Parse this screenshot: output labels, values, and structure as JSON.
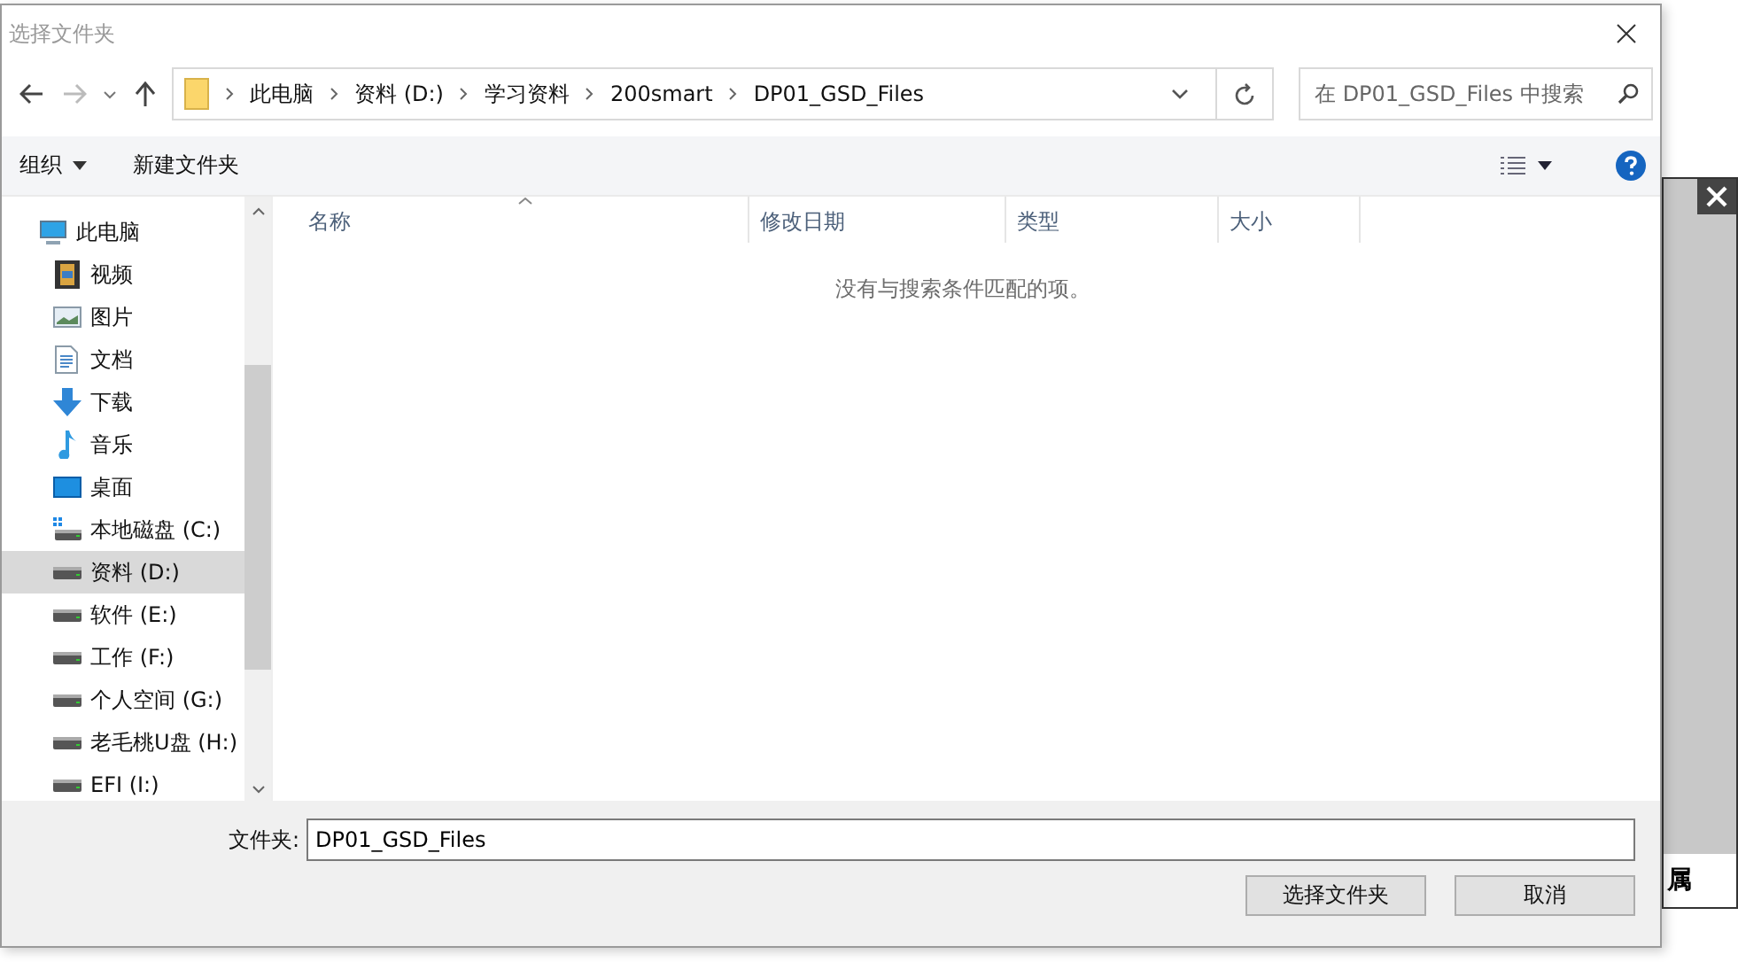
{
  "window": {
    "title": "选择文件夹"
  },
  "address_bar": {
    "segments": [
      "此电脑",
      "资料 (D:)",
      "学习资料",
      "200smart",
      "DP01_GSD_Files"
    ]
  },
  "search": {
    "placeholder": "在 DP01_GSD_Files 中搜索"
  },
  "toolbar": {
    "organize": "组织",
    "new_folder": "新建文件夹"
  },
  "sidebar": {
    "items": [
      {
        "label": "此电脑",
        "kind": "pc",
        "selected": false,
        "children": [
          {
            "label": "视频",
            "kind": "video",
            "selected": false
          },
          {
            "label": "图片",
            "kind": "pictures",
            "selected": false
          },
          {
            "label": "文档",
            "kind": "documents",
            "selected": false
          },
          {
            "label": "下载",
            "kind": "downloads",
            "selected": false
          },
          {
            "label": "音乐",
            "kind": "music",
            "selected": false
          },
          {
            "label": "桌面",
            "kind": "desktop",
            "selected": false
          },
          {
            "label": "本地磁盘 (C:)",
            "kind": "system-drive",
            "selected": false
          },
          {
            "label": "资料 (D:)",
            "kind": "drive",
            "selected": true
          },
          {
            "label": "软件 (E:)",
            "kind": "drive",
            "selected": false
          },
          {
            "label": "工作 (F:)",
            "kind": "drive",
            "selected": false
          },
          {
            "label": "个人空间 (G:)",
            "kind": "drive",
            "selected": false
          },
          {
            "label": "老毛桃U盘 (H:)",
            "kind": "drive",
            "selected": false
          },
          {
            "label": "EFI (I:)",
            "kind": "drive",
            "selected": false
          }
        ]
      }
    ]
  },
  "file_list": {
    "columns": [
      "名称",
      "修改日期",
      "类型",
      "大小"
    ],
    "empty_message": "没有与搜索条件匹配的项。"
  },
  "folder_field": {
    "label": "文件夹:",
    "value": "DP01_GSD_Files"
  },
  "buttons": [
    "选择文件夹",
    "取消"
  ],
  "background_window": {
    "cut_label": "属"
  }
}
